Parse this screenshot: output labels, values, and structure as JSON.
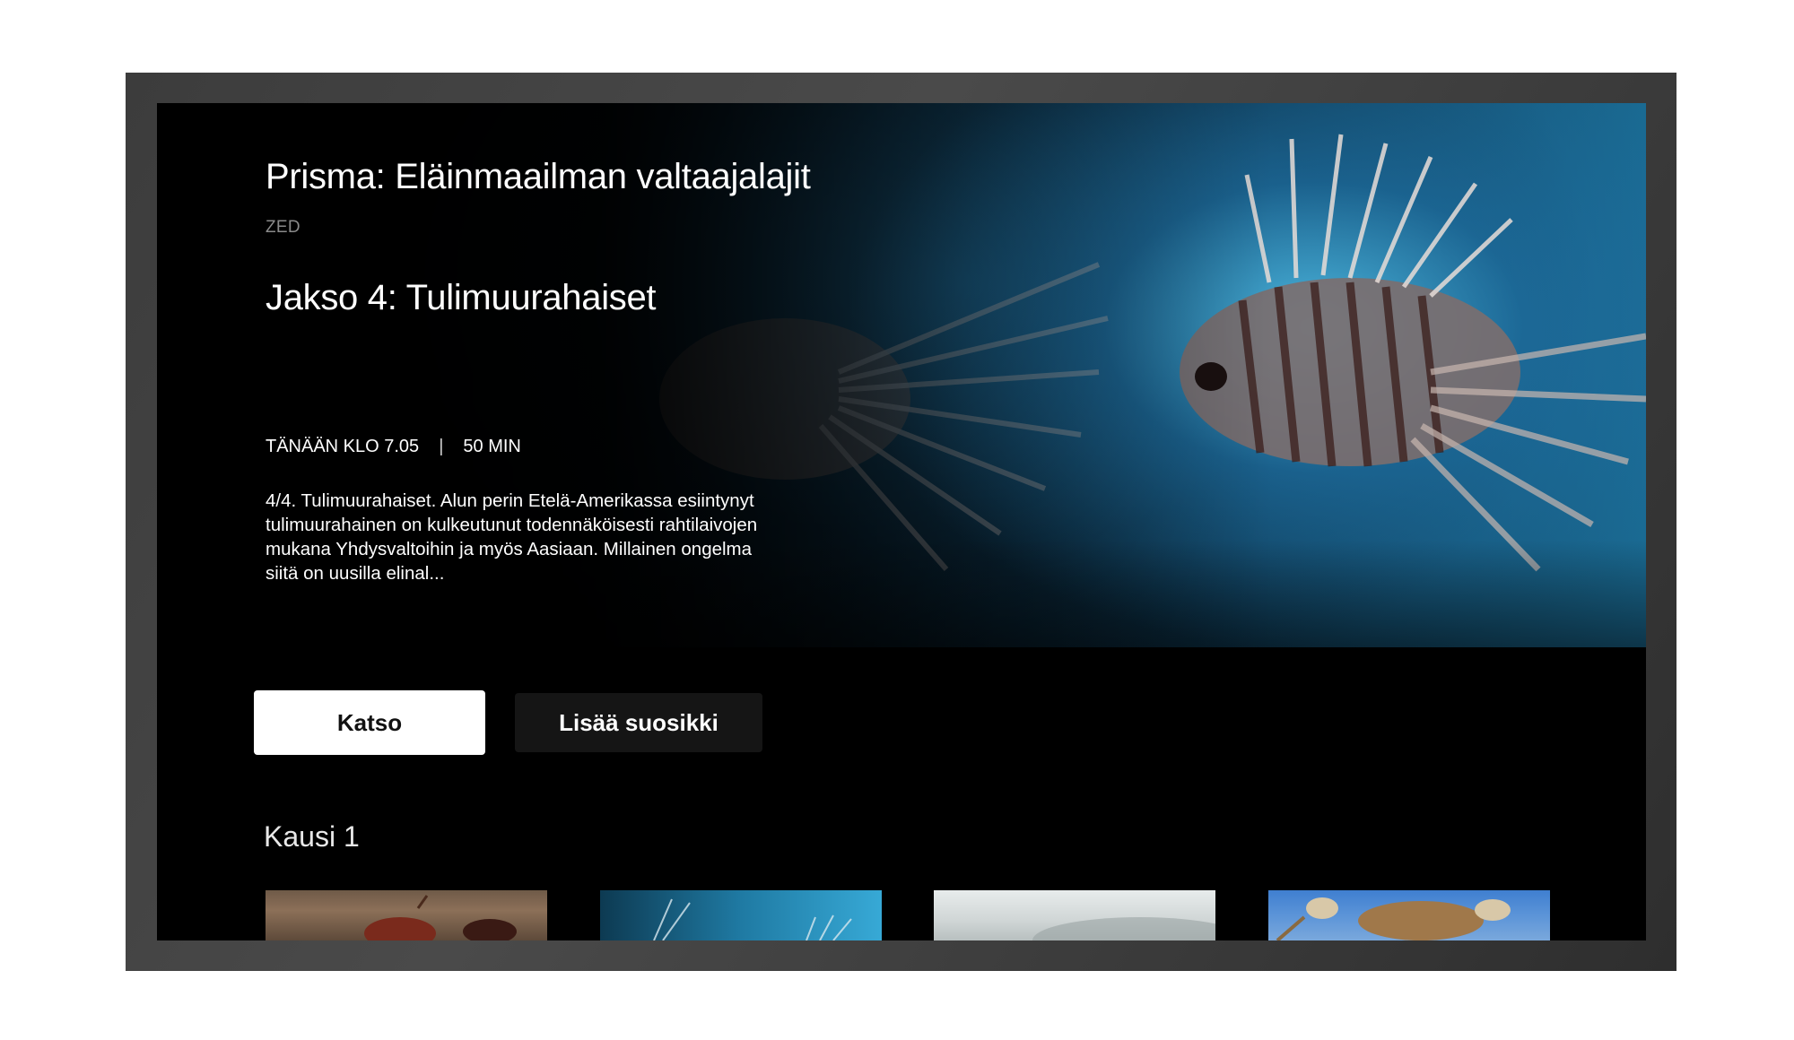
{
  "hero": {
    "series_title": "Prisma: Eläinmaailman valtaajalajit",
    "channel": "ZED",
    "episode_title": "Jakso 4: Tulimuurahaiset",
    "air_time": "TÄNÄÄN KLO 7.05",
    "separator": "|",
    "duration": "50 MIN",
    "description": "4/4. Tulimuurahaiset. Alun perin Etelä-Amerikassa esiintynyt tulimuurahainen on kulkeutunut todennäköisesti rahtilaivojen mukana Yhdysvaltoihin ja myös Aasiaan. Millainen ongelma siitä on uusilla elinal..."
  },
  "actions": {
    "watch_label": "Katso",
    "favorite_label": "Lisää suosikki"
  },
  "season": {
    "label": "Kausi 1",
    "episodes": [
      {
        "thumbnail": "fire-ants-thumbnail"
      },
      {
        "thumbnail": "lionfish-thumbnail"
      },
      {
        "thumbnail": "misty-landscape-thumbnail"
      },
      {
        "thumbnail": "crab-thumbnail"
      }
    ]
  },
  "colors": {
    "background": "#000000",
    "primary_button": "#ffffff",
    "secondary_button": "#151515",
    "accent_water": "#37a9d6"
  }
}
